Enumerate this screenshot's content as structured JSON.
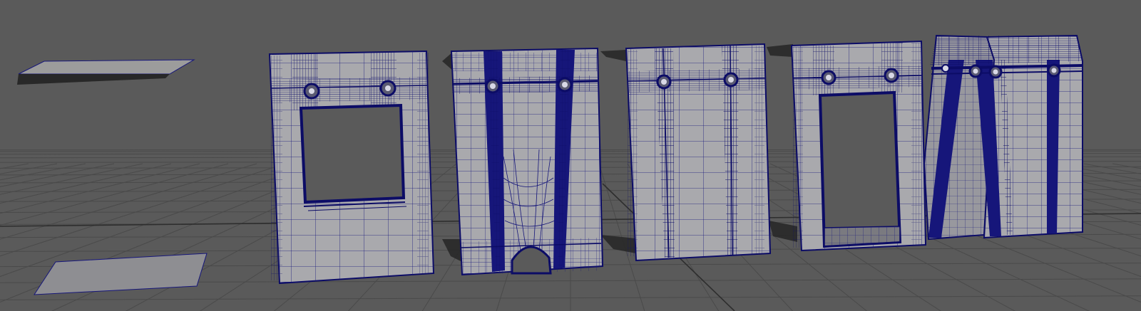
{
  "viewport": {
    "kind": "3d-perspective-viewport",
    "shading": "wireframe-on-shaded",
    "colors": {
      "background": "#5a5a5a",
      "grid": "#4a4a4a",
      "grid_major": "#2e2e2e",
      "surface": "#a8a8ac",
      "wire": "#16167a",
      "wire_strong": "#0c0c66",
      "shadow": "#202020"
    }
  },
  "scene": {
    "objects": [
      {
        "id": "plane-floating",
        "type": "plane"
      },
      {
        "id": "plane-ground",
        "type": "plane"
      },
      {
        "id": "panel-window",
        "type": "wall-panel",
        "features": [
          "window-opening",
          "two-bolts"
        ]
      },
      {
        "id": "panel-arch",
        "type": "wall-panel",
        "features": [
          "two-vertical-beams",
          "two-bolts",
          "arch-opening"
        ]
      },
      {
        "id": "panel-plain",
        "type": "wall-panel",
        "features": [
          "two-vertical-beams",
          "two-bolts"
        ]
      },
      {
        "id": "panel-door",
        "type": "wall-panel",
        "features": [
          "door-opening",
          "two-bolts"
        ]
      },
      {
        "id": "panel-angled",
        "type": "wall-panel",
        "features": [
          "angled-beams",
          "three-bolts"
        ]
      }
    ]
  }
}
